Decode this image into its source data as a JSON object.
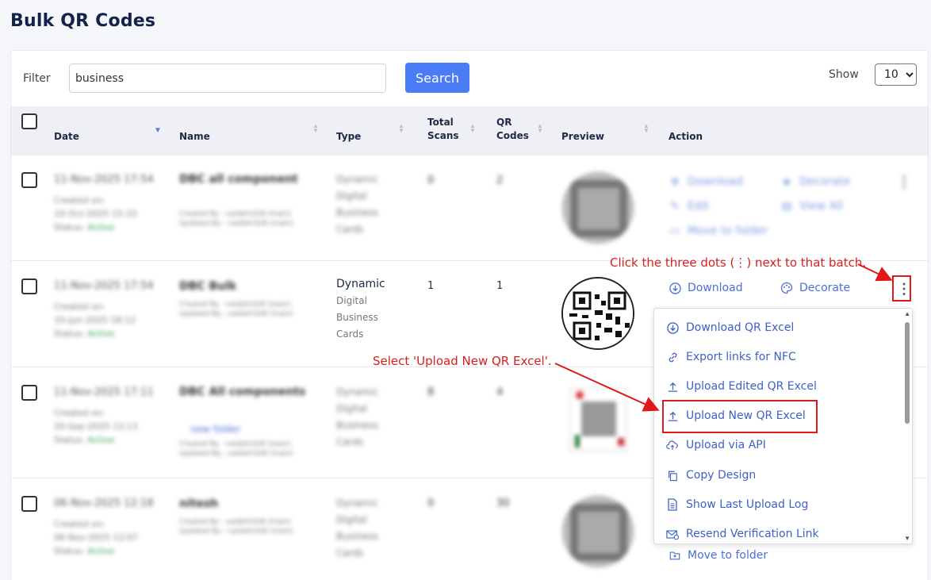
{
  "page": {
    "title": "Bulk QR Codes"
  },
  "filter": {
    "label": "Filter",
    "value": "business",
    "search_label": "Search",
    "show_label": "Show",
    "show_value": "10"
  },
  "table": {
    "headers": {
      "date": "Date",
      "name": "Name",
      "type": "Type",
      "total_scans_1": "Total",
      "total_scans_2": "Scans",
      "qr_codes_1": "QR",
      "qr_codes_2": "Codes",
      "preview": "Preview",
      "action": "Action"
    },
    "rows": [
      {
        "date": "11-Nov-2025 17:54",
        "created_on_label": "Created on:",
        "created_on": "10-Oct-2025 15:33",
        "status_label": "Status:",
        "status": "Active",
        "name": "DBC all component",
        "created_by": "Created By : vaidehi328 (main)",
        "updated_by": "Updated By : vaidehi328 (main)",
        "type": [
          "Dynamic",
          "Digital",
          "Business",
          "Cards"
        ],
        "total_scans": "0",
        "qr_codes": "2",
        "actions": [
          "Download",
          "Decorate",
          "Edit",
          "View All",
          "Move to folder"
        ]
      },
      {
        "date": "11-Nov-2025 17:54",
        "created_on_label": "Created on:",
        "created_on": "10-Jun-2025 18:12",
        "status_label": "Status:",
        "status": "Active",
        "name": "DBC Bulk",
        "created_by": "Created By : vaidehi328 (main)",
        "updated_by": "Updated By : vaidehi328 (main)",
        "type": [
          "Dynamic",
          "Digital",
          "Business",
          "Cards"
        ],
        "total_scans": "1",
        "qr_codes": "1",
        "actions": [
          "Download",
          "Decorate"
        ]
      },
      {
        "date": "11-Nov-2025 17:11",
        "created_on_label": "Created on:",
        "created_on": "20-Sep-2025 12:13",
        "status_label": "Status:",
        "status": "Active",
        "name": "DBC All components",
        "folder": "new folder",
        "created_by": "Created By : vaidehi328 (main)",
        "updated_by": "Updated By : vaidehi328 (main)",
        "type": [
          "Dynamic",
          "Digital",
          "Business",
          "Cards"
        ],
        "total_scans": "8",
        "qr_codes": "4"
      },
      {
        "date": "06-Nov-2025 12:18",
        "created_on_label": "Created on:",
        "created_on": "06-Nov-2025 12:07",
        "status_label": "Status:",
        "status": "Active",
        "name": "nitesh",
        "created_by": "Created By : vaidehi328 (main)",
        "updated_by": "Updated By : vaidehi328 (main)",
        "type": [
          "Dynamic",
          "Digital",
          "Business",
          "Cards"
        ],
        "total_scans": "0",
        "qr_codes": "30",
        "actions": [
          "Move to folder"
        ]
      }
    ]
  },
  "menu": {
    "items": [
      {
        "label": "Download QR Excel",
        "icon": "download-circle-icon"
      },
      {
        "label": "Export links for NFC",
        "icon": "link-icon"
      },
      {
        "label": "Upload Edited QR Excel",
        "icon": "upload-icon"
      },
      {
        "label": "Upload New QR Excel",
        "icon": "upload-icon"
      },
      {
        "label": "Upload via API",
        "icon": "cloud-upload-icon"
      },
      {
        "label": "Copy Design",
        "icon": "copy-icon"
      },
      {
        "label": "Show Last Upload Log",
        "icon": "document-icon"
      },
      {
        "label": "Resend Verification Link",
        "icon": "mail-icon"
      }
    ]
  },
  "annotations": {
    "step1": "Click the three dots (⋮) next to that batch.",
    "step2": "Select 'Upload New QR Excel'."
  },
  "colors": {
    "accent": "#4a7cf6",
    "link": "#4a6fd8",
    "annotation": "#e01818",
    "status_active": "#2e9e4f"
  }
}
